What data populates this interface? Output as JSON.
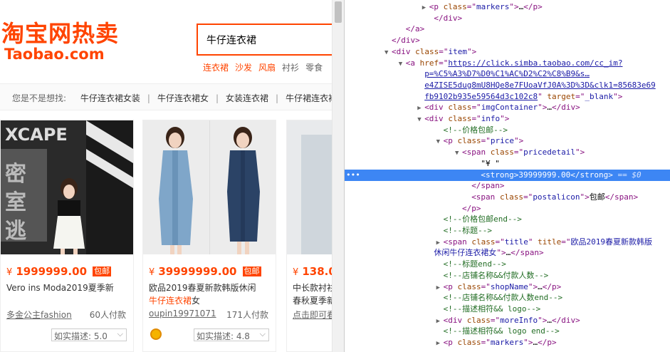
{
  "taobao": {
    "logo_main": "淘宝网热卖",
    "logo_sub": "Taobao.com",
    "search_value": "牛仔连衣裙",
    "hot_words": [
      {
        "label": "连衣裙",
        "color": "#f40"
      },
      {
        "label": "沙发",
        "color": "#f40"
      },
      {
        "label": "风扇",
        "color": "#f40"
      },
      {
        "label": "衬衫",
        "color": "#666"
      },
      {
        "label": "零食",
        "color": "#666"
      }
    ],
    "suggest_hint": "您是不是想找:",
    "suggestions": [
      "牛仔连衣裙女装",
      "牛仔连衣裙女",
      "女装连衣裙",
      "牛仔裙连衣裙"
    ],
    "products": [
      {
        "yen": "¥",
        "price": "1999999.00",
        "tag": "包邮",
        "title_plain": "Vero ins Moda2019夏季新",
        "title_hl": "",
        "title_rest": "",
        "shop": "多金公主fashion",
        "paid": "60人付款",
        "rating": "如实描述: 5.0"
      },
      {
        "yen": "¥",
        "price": "39999999.00",
        "tag": "包邮",
        "title_plain": "欧品2019春夏新款韩版休闲",
        "title_hl": "牛仔连衣裙",
        "title_rest": "女",
        "shop": "oupin19971071",
        "paid": "171人付款",
        "rating": "如实描述: 4.8"
      },
      {
        "yen": "¥",
        "price": "138.0",
        "tag": "",
        "title_plain": "中长款衬衫",
        "title_hl": "",
        "title_rest": "春秋夏季新",
        "shop": "点击即可看",
        "paid": "",
        "rating": ""
      }
    ]
  },
  "devtools": {
    "lines": [
      {
        "indent": 18,
        "tri": "▶",
        "parts": [
          [
            "t",
            "<p "
          ],
          [
            "an",
            "class"
          ],
          [
            "t",
            "=\""
          ],
          [
            "av",
            "markers"
          ],
          [
            "t",
            "\">"
          ],
          [
            "tx",
            "…"
          ],
          [
            "t",
            "</p>"
          ]
        ]
      },
      {
        "indent": 19,
        "tri": "",
        "parts": [
          [
            "t",
            "</div>"
          ]
        ]
      },
      {
        "indent": 13,
        "tri": "",
        "parts": [
          [
            "t",
            "</a>"
          ]
        ]
      },
      {
        "indent": 10,
        "tri": "",
        "parts": [
          [
            "t",
            "</div>"
          ]
        ]
      },
      {
        "indent": 10,
        "tri": "▼",
        "parts": [
          [
            "t",
            "<div "
          ],
          [
            "an",
            "class"
          ],
          [
            "t",
            "=\""
          ],
          [
            "av",
            "item"
          ],
          [
            "t",
            "\">"
          ]
        ]
      },
      {
        "indent": 13,
        "tri": "▼",
        "parts": [
          [
            "t",
            "<a "
          ],
          [
            "an",
            "href"
          ],
          [
            "t",
            "=\""
          ],
          [
            "lk",
            "https://click.simba.taobao.com/cc_im?"
          ]
        ]
      },
      {
        "indent": 17,
        "tri": "",
        "parts": [
          [
            "lk",
            "p=%C5%A3%D7%D0%C1%AC%D2%C2%C8%B9&s…"
          ]
        ]
      },
      {
        "indent": 17,
        "tri": "",
        "parts": [
          [
            "lk",
            "e4ZISE5dug8mU8HQe8e7FUoaVfJ0A%3D%3D&clk1=85683e69"
          ]
        ]
      },
      {
        "indent": 17,
        "tri": "",
        "parts": [
          [
            "lk",
            "fb9102b935e59564d3c102c8"
          ],
          [
            "t",
            "\" "
          ],
          [
            "an",
            "target"
          ],
          [
            "t",
            "=\""
          ],
          [
            "av",
            "_blank"
          ],
          [
            "t",
            "\">"
          ]
        ]
      },
      {
        "indent": 17,
        "tri": "▶",
        "parts": [
          [
            "t",
            "<div "
          ],
          [
            "an",
            "class"
          ],
          [
            "t",
            "=\""
          ],
          [
            "av",
            "imgContainer"
          ],
          [
            "t",
            "\">"
          ],
          [
            "tx",
            "…"
          ],
          [
            "t",
            "</div>"
          ]
        ]
      },
      {
        "indent": 17,
        "tri": "▼",
        "parts": [
          [
            "t",
            "<div "
          ],
          [
            "an",
            "class"
          ],
          [
            "t",
            "=\""
          ],
          [
            "av",
            "info"
          ],
          [
            "t",
            "\">"
          ]
        ]
      },
      {
        "indent": 21,
        "tri": "",
        "parts": [
          [
            "cm",
            "<!--价格包邮-->"
          ]
        ]
      },
      {
        "indent": 21,
        "tri": "▼",
        "parts": [
          [
            "t",
            "<p "
          ],
          [
            "an",
            "class"
          ],
          [
            "t",
            "=\""
          ],
          [
            "av",
            "price"
          ],
          [
            "t",
            "\">"
          ]
        ]
      },
      {
        "indent": 25,
        "tri": "▼",
        "parts": [
          [
            "t",
            "<span "
          ],
          [
            "an",
            "class"
          ],
          [
            "t",
            "=\""
          ],
          [
            "av",
            "pricedetail"
          ],
          [
            "t",
            "\">"
          ]
        ]
      },
      {
        "indent": 29,
        "tri": "",
        "parts": [
          [
            "tx",
            "\"¥ \""
          ]
        ]
      },
      {
        "indent": 29,
        "tri": "",
        "sel": true,
        "parts": [
          [
            "t",
            "<strong>"
          ],
          [
            "tx",
            "39999999.00"
          ],
          [
            "t",
            "</strong>"
          ],
          [
            "eq",
            " == $0"
          ]
        ]
      },
      {
        "indent": 27,
        "tri": "",
        "parts": [
          [
            "t",
            "</span>"
          ]
        ]
      },
      {
        "indent": 27,
        "tri": "",
        "parts": [
          [
            "t",
            "<span "
          ],
          [
            "an",
            "class"
          ],
          [
            "t",
            "=\""
          ],
          [
            "av",
            "postalicon"
          ],
          [
            "t",
            "\">"
          ],
          [
            "tx",
            "包邮"
          ],
          [
            "t",
            "</span>"
          ]
        ]
      },
      {
        "indent": 25,
        "tri": "",
        "parts": [
          [
            "t",
            "</p>"
          ]
        ]
      },
      {
        "indent": 21,
        "tri": "",
        "parts": [
          [
            "cm",
            "<!--价格包邮end-->"
          ]
        ]
      },
      {
        "indent": 21,
        "tri": "",
        "parts": [
          [
            "cm",
            "<!--标题-->"
          ]
        ]
      },
      {
        "indent": 21,
        "tri": "▶",
        "parts": [
          [
            "t",
            "<span "
          ],
          [
            "an",
            "class"
          ],
          [
            "t",
            "=\""
          ],
          [
            "av",
            "title"
          ],
          [
            "t",
            "\" "
          ],
          [
            "an",
            "title"
          ],
          [
            "t",
            "=\""
          ],
          [
            "av",
            "欧品2019春夏新款韩版"
          ]
        ]
      },
      {
        "indent": 19,
        "tri": "",
        "parts": [
          [
            "av",
            "休闲牛仔连衣裙女"
          ],
          [
            "t",
            "\">"
          ],
          [
            "tx",
            "…"
          ],
          [
            "t",
            "</span>"
          ]
        ]
      },
      {
        "indent": 21,
        "tri": "",
        "parts": [
          [
            "cm",
            "<!--标题end-->"
          ]
        ]
      },
      {
        "indent": 21,
        "tri": "",
        "parts": [
          [
            "cm",
            "<!--店铺名称&&付款人数-->"
          ]
        ]
      },
      {
        "indent": 21,
        "tri": "▶",
        "parts": [
          [
            "t",
            "<p "
          ],
          [
            "an",
            "class"
          ],
          [
            "t",
            "=\""
          ],
          [
            "av",
            "shopName"
          ],
          [
            "t",
            "\">"
          ],
          [
            "tx",
            "…"
          ],
          [
            "t",
            "</p>"
          ]
        ]
      },
      {
        "indent": 21,
        "tri": "",
        "parts": [
          [
            "cm",
            "<!--店铺名称&&付款人数end-->"
          ]
        ]
      },
      {
        "indent": 21,
        "tri": "",
        "parts": [
          [
            "cm",
            "<!--描述相符&& logo-->"
          ]
        ]
      },
      {
        "indent": 21,
        "tri": "▶",
        "parts": [
          [
            "t",
            "<div "
          ],
          [
            "an",
            "class"
          ],
          [
            "t",
            "=\""
          ],
          [
            "av",
            "moreInfo"
          ],
          [
            "t",
            "\">"
          ],
          [
            "tx",
            "…"
          ],
          [
            "t",
            "</div>"
          ]
        ]
      },
      {
        "indent": 21,
        "tri": "",
        "parts": [
          [
            "cm",
            "<!--描述相符&& logo end-->"
          ]
        ]
      },
      {
        "indent": 21,
        "tri": "▶",
        "parts": [
          [
            "t",
            "<p "
          ],
          [
            "an",
            "class"
          ],
          [
            "t",
            "=\""
          ],
          [
            "av",
            "markers"
          ],
          [
            "t",
            "\">"
          ],
          [
            "tx",
            "…"
          ],
          [
            "t",
            "</p>"
          ]
        ]
      }
    ]
  }
}
